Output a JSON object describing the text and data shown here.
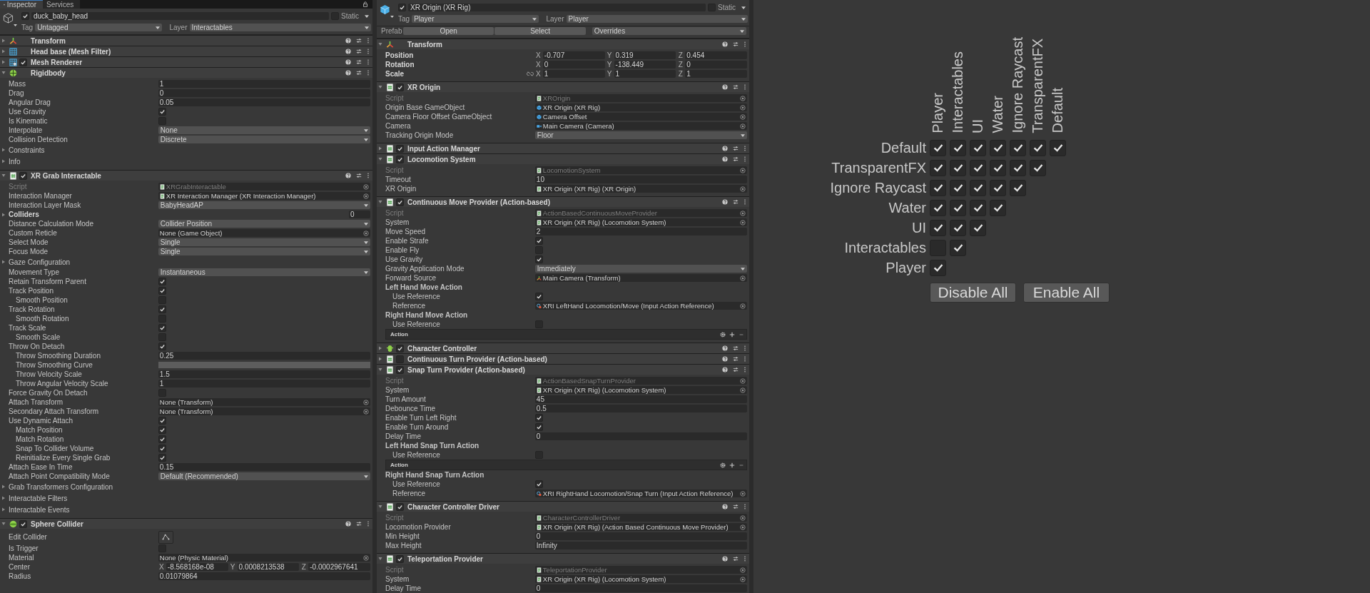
{
  "inspectors": [
    {
      "tabs": [
        {
          "label": "Inspector",
          "selected": true
        },
        {
          "label": "Services",
          "selected": false
        }
      ],
      "object": {
        "kind": "gameobject",
        "active": true,
        "name": "duck_baby_head",
        "static_label": "Static",
        "static": false,
        "tag_label": "Tag",
        "tag": "Untagged",
        "layer_label": "Layer",
        "layer": "Interactables"
      },
      "components": [
        {
          "name": "Transform",
          "kind": "transform",
          "expanded": false
        },
        {
          "name": "Head base (Mesh Filter)",
          "kind": "mesh-filter",
          "expanded": false
        },
        {
          "name": "Mesh Renderer",
          "kind": "mesh-renderer",
          "expanded": false,
          "enabled": true
        },
        {
          "name": "Rigidbody",
          "kind": "rigidbody",
          "expanded": true,
          "rows": [
            {
              "kind": "float",
              "label": "Mass",
              "value": "1"
            },
            {
              "kind": "float",
              "label": "Drag",
              "value": "0"
            },
            {
              "kind": "float",
              "label": "Angular Drag",
              "value": "0.05"
            },
            {
              "kind": "check",
              "label": "Use Gravity",
              "checked": true
            },
            {
              "kind": "check",
              "label": "Is Kinematic",
              "checked": false
            },
            {
              "kind": "dropdown",
              "label": "Interpolate",
              "value": "None"
            },
            {
              "kind": "dropdown",
              "label": "Collision Detection",
              "value": "Discrete"
            },
            {
              "kind": "foldout",
              "label": "Constraints"
            },
            {
              "kind": "foldout",
              "label": "Info"
            }
          ]
        },
        {
          "name": "XR Grab Interactable",
          "kind": "script",
          "expanded": true,
          "enabled": true,
          "rows": [
            {
              "kind": "script",
              "label": "Script",
              "value": "XRGrabInteractable"
            },
            {
              "kind": "object_script",
              "label": "Interaction Manager",
              "value": "XR Interaction Manager (XR Interaction Manager)"
            },
            {
              "kind": "dropdown",
              "label": "Interaction Layer Mask",
              "value": "BabyHeadAP"
            },
            {
              "kind": "array",
              "label": "Colliders",
              "value": "0"
            },
            {
              "kind": "dropdown",
              "label": "Distance Calculation Mode",
              "value": "Collider Position"
            },
            {
              "kind": "object",
              "label": "Custom Reticle",
              "value": "None (Game Object)"
            },
            {
              "kind": "dropdown",
              "label": "Select Mode",
              "value": "Single"
            },
            {
              "kind": "dropdown",
              "label": "Focus Mode",
              "value": "Single"
            },
            {
              "kind": "foldout",
              "label": "Gaze Configuration"
            },
            {
              "kind": "dropdown",
              "label": "Movement Type",
              "value": "Instantaneous"
            },
            {
              "kind": "check",
              "label": "Retain Transform Parent",
              "checked": true
            },
            {
              "kind": "check",
              "label": "Track Position",
              "checked": true,
              "children": [
                {
                  "kind": "check",
                  "label": "Smooth Position",
                  "checked": false
                }
              ]
            },
            {
              "kind": "check",
              "label": "Track Rotation",
              "checked": true,
              "children": [
                {
                  "kind": "check",
                  "label": "Smooth Rotation",
                  "checked": false
                }
              ]
            },
            {
              "kind": "check",
              "label": "Track Scale",
              "checked": true,
              "children": [
                {
                  "kind": "check",
                  "label": "Smooth Scale",
                  "checked": false
                }
              ]
            },
            {
              "kind": "check",
              "label": "Throw On Detach",
              "checked": true,
              "children": [
                {
                  "kind": "float",
                  "label": "Throw Smoothing Duration",
                  "value": "0.25"
                },
                {
                  "kind": "curve",
                  "label": "Throw Smoothing Curve"
                },
                {
                  "kind": "float",
                  "label": "Throw Velocity Scale",
                  "value": "1.5"
                },
                {
                  "kind": "float",
                  "label": "Throw Angular Velocity Scale",
                  "value": "1"
                }
              ]
            },
            {
              "kind": "check",
              "label": "Force Gravity On Detach",
              "checked": false
            },
            {
              "kind": "object",
              "label": "Attach Transform",
              "value": "None (Transform)"
            },
            {
              "kind": "object",
              "label": "Secondary Attach Transform",
              "value": "None (Transform)"
            },
            {
              "kind": "check",
              "label": "Use Dynamic Attach",
              "checked": true,
              "children": [
                {
                  "kind": "check",
                  "label": "Match Position",
                  "checked": true
                },
                {
                  "kind": "check",
                  "label": "Match Rotation",
                  "checked": true
                },
                {
                  "kind": "check",
                  "label": "Snap To Collider Volume",
                  "checked": true
                },
                {
                  "kind": "check",
                  "label": "Reinitialize Every Single Grab",
                  "checked": true
                }
              ]
            },
            {
              "kind": "float",
              "label": "Attach Ease In Time",
              "value": "0.15"
            },
            {
              "kind": "dropdown",
              "label": "Attach Point Compatibility Mode",
              "value": "Default (Recommended)"
            },
            {
              "kind": "foldout",
              "label": "Grab Transformers Configuration"
            },
            {
              "kind": "foldout",
              "label": "Interactable Filters"
            },
            {
              "kind": "foldout",
              "label": "Interactable Events"
            }
          ]
        },
        {
          "name": "Sphere Collider",
          "kind": "sphere-collider",
          "expanded": true,
          "enabled": true,
          "rows": [
            {
              "kind": "button",
              "label": "Edit Collider"
            },
            {
              "kind": "check",
              "label": "Is Trigger",
              "checked": false
            },
            {
              "kind": "object",
              "label": "Material",
              "value": "None (Physic Material)"
            },
            {
              "kind": "vector",
              "label": "Center",
              "overridden": false,
              "axes": [
                {
                  "axis": "X",
                  "value": "-8.568168e-08"
                },
                {
                  "axis": "Y",
                  "value": "0.0008213538"
                },
                {
                  "axis": "Z",
                  "value": "-0.0002967641"
                }
              ]
            },
            {
              "kind": "float",
              "label": "Radius",
              "value": "0.01079864"
            }
          ]
        }
      ]
    },
    {
      "object": {
        "kind": "prefab",
        "active": true,
        "name": "XR Origin (XR Rig)",
        "static_label": "Static",
        "static": false,
        "tag_label": "Tag",
        "tag": "Player",
        "layer_label": "Layer",
        "layer": "Player",
        "prefab": {
          "label": "Prefab",
          "buttons": [
            "Open",
            "Select"
          ],
          "overrides": "Overrides"
        }
      },
      "components": [
        {
          "name": "Transform",
          "kind": "transform",
          "expanded": true,
          "rows": [
            {
              "kind": "vector",
              "label": "Position",
              "overridden": true,
              "axes": [
                {
                  "axis": "X",
                  "value": "-0.707"
                },
                {
                  "axis": "Y",
                  "value": "0.319"
                },
                {
                  "axis": "Z",
                  "value": "0.454"
                }
              ]
            },
            {
              "kind": "vector",
              "label": "Rotation",
              "overridden": true,
              "axes": [
                {
                  "axis": "X",
                  "value": "0"
                },
                {
                  "axis": "Y",
                  "value": "-138.449"
                },
                {
                  "axis": "Z",
                  "value": "0"
                }
              ]
            },
            {
              "kind": "vector",
              "label": "Scale",
              "overridden": true,
              "constrained": false,
              "axes": [
                {
                  "axis": "X",
                  "value": "1"
                },
                {
                  "axis": "Y",
                  "value": "1"
                },
                {
                  "axis": "Z",
                  "value": "1"
                }
              ]
            }
          ]
        },
        {
          "name": "XR Origin",
          "kind": "script",
          "expanded": true,
          "enabled": true,
          "rows": [
            {
              "kind": "script",
              "label": "Script",
              "value": "XROrigin"
            },
            {
              "kind": "object_gameobject",
              "label": "Origin Base GameObject",
              "value": "XR Origin (XR Rig)"
            },
            {
              "kind": "object_gameobject",
              "label": "Camera Floor Offset GameObject",
              "value": "Camera Offset"
            },
            {
              "kind": "object_camera",
              "label": "Camera",
              "value": "Main Camera (Camera)"
            },
            {
              "kind": "dropdown",
              "label": "Tracking Origin Mode",
              "value": "Floor"
            }
          ]
        },
        {
          "name": "Input Action Manager",
          "kind": "script",
          "expanded": false,
          "enabled": true
        },
        {
          "name": "Locomotion System",
          "kind": "script",
          "expanded": true,
          "enabled": true,
          "rows": [
            {
              "kind": "script",
              "label": "Script",
              "value": "LocomotionSystem"
            },
            {
              "kind": "float",
              "label": "Timeout",
              "value": "10"
            },
            {
              "kind": "object_script",
              "label": "XR Origin",
              "value": "XR Origin (XR Rig) (XR Origin)"
            }
          ]
        },
        {
          "name": "Continuous Move Provider (Action-based)",
          "kind": "script",
          "expanded": true,
          "enabled": true,
          "rows": [
            {
              "kind": "script",
              "label": "Script",
              "value": "ActionBasedContinuousMoveProvider"
            },
            {
              "kind": "object_script",
              "label": "System",
              "value": "XR Origin (XR Rig) (Locomotion System)"
            },
            {
              "kind": "float",
              "label": "Move Speed",
              "value": "2"
            },
            {
              "kind": "check",
              "label": "Enable Strafe",
              "checked": true
            },
            {
              "kind": "check",
              "label": "Enable Fly",
              "checked": false
            },
            {
              "kind": "check",
              "label": "Use Gravity",
              "checked": true
            },
            {
              "kind": "dropdown",
              "label": "Gravity Application Mode",
              "value": "Immediately"
            },
            {
              "kind": "object_transform",
              "label": "Forward Source",
              "value": "Main Camera (Transform)"
            },
            {
              "kind": "header",
              "label": "Left Hand Move Action",
              "children": [
                {
                  "kind": "check",
                  "label": "Use Reference",
                  "checked": true
                },
                {
                  "kind": "object_action",
                  "label": "Reference",
                  "value": "XRI LeftHand Locomotion/Move (Input Action Reference)"
                }
              ]
            },
            {
              "kind": "header",
              "label": "Right Hand Move Action",
              "children": [
                {
                  "kind": "check",
                  "label": "Use Reference",
                  "checked": false
                },
                {
                  "kind": "action",
                  "label": "Action"
                }
              ]
            }
          ]
        },
        {
          "name": "Character Controller",
          "kind": "character-controller",
          "expanded": false,
          "enabled": true
        },
        {
          "name": "Continuous Turn Provider (Action-based)",
          "kind": "script",
          "expanded": false,
          "enabled": false
        },
        {
          "name": "Snap Turn Provider (Action-based)",
          "kind": "script",
          "expanded": true,
          "enabled": true,
          "rows": [
            {
              "kind": "script",
              "label": "Script",
              "value": "ActionBasedSnapTurnProvider"
            },
            {
              "kind": "object_script",
              "label": "System",
              "value": "XR Origin (XR Rig) (Locomotion System)"
            },
            {
              "kind": "float",
              "label": "Turn Amount",
              "value": "45"
            },
            {
              "kind": "float",
              "label": "Debounce Time",
              "value": "0.5"
            },
            {
              "kind": "check",
              "label": "Enable Turn Left Right",
              "checked": true
            },
            {
              "kind": "check",
              "label": "Enable Turn Around",
              "checked": true
            },
            {
              "kind": "float",
              "label": "Delay Time",
              "value": "0"
            },
            {
              "kind": "header",
              "label": "Left Hand Snap Turn Action",
              "children": [
                {
                  "kind": "check",
                  "label": "Use Reference",
                  "checked": false
                },
                {
                  "kind": "action",
                  "label": "Action"
                }
              ]
            },
            {
              "kind": "header",
              "label": "Right Hand Snap Turn Action",
              "children": [
                {
                  "kind": "check",
                  "label": "Use Reference",
                  "checked": true
                },
                {
                  "kind": "object_action",
                  "label": "Reference",
                  "value": "XRI RightHand Locomotion/Snap Turn (Input Action Reference)"
                }
              ]
            }
          ]
        },
        {
          "name": "Character Controller Driver",
          "kind": "script",
          "expanded": true,
          "enabled": true,
          "rows": [
            {
              "kind": "script",
              "label": "Script",
              "value": "CharacterControllerDriver"
            },
            {
              "kind": "object_script",
              "label": "Locomotion Provider",
              "value": "XR Origin (XR Rig) (Action Based Continuous Move Provider)"
            },
            {
              "kind": "float",
              "label": "Min Height",
              "value": "0"
            },
            {
              "kind": "float",
              "label": "Max Height",
              "value": "Infinity"
            }
          ]
        },
        {
          "name": "Teleportation Provider",
          "kind": "script",
          "expanded": true,
          "enabled": true,
          "rows": [
            {
              "kind": "script",
              "label": "Script",
              "value": "TeleportationProvider"
            },
            {
              "kind": "object_script",
              "label": "System",
              "value": "XR Origin (XR Rig) (Locomotion System)"
            },
            {
              "kind": "float",
              "label": "Delay Time",
              "value": "0"
            }
          ]
        }
      ]
    }
  ],
  "collision_matrix": {
    "columns": [
      "Player",
      "Interactables",
      "UI",
      "Water",
      "Ignore Raycast",
      "TransparentFX",
      "Default"
    ],
    "rows": [
      {
        "label": "Default",
        "cells": [
          true,
          true,
          true,
          true,
          true,
          true,
          true
        ]
      },
      {
        "label": "TransparentFX",
        "cells": [
          true,
          true,
          true,
          true,
          true,
          true
        ]
      },
      {
        "label": "Ignore Raycast",
        "cells": [
          true,
          true,
          true,
          true,
          true
        ]
      },
      {
        "label": "Water",
        "cells": [
          true,
          true,
          true,
          true
        ]
      },
      {
        "label": "UI",
        "cells": [
          true,
          true,
          true
        ]
      },
      {
        "label": "Interactables",
        "cells": [
          false,
          true
        ]
      },
      {
        "label": "Player",
        "cells": [
          true
        ]
      }
    ],
    "buttons": [
      "Disable All",
      "Enable All"
    ]
  }
}
